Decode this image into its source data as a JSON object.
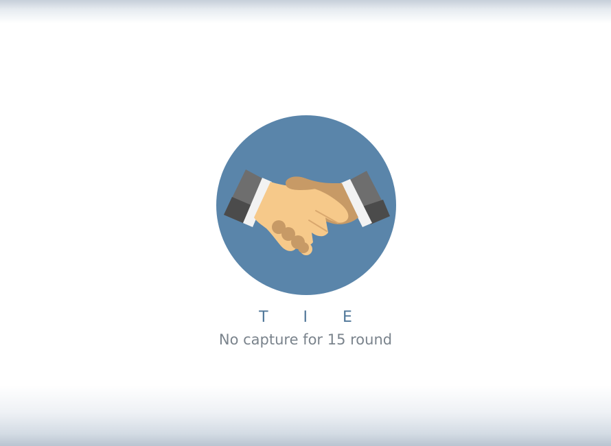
{
  "result": {
    "title": "T I E",
    "subtitle": "No capture for 15 round",
    "icon": "handshake-icon"
  },
  "colors": {
    "circle": "#5a85aa",
    "skin_light": "#f6c98a",
    "skin_dark": "#c79a66",
    "cuff": "#f2f2f2",
    "sleeve_light": "#6e6e6e",
    "sleeve_dark": "#4b4b4b",
    "title": "#4f7698",
    "subtitle": "#7a838c"
  }
}
